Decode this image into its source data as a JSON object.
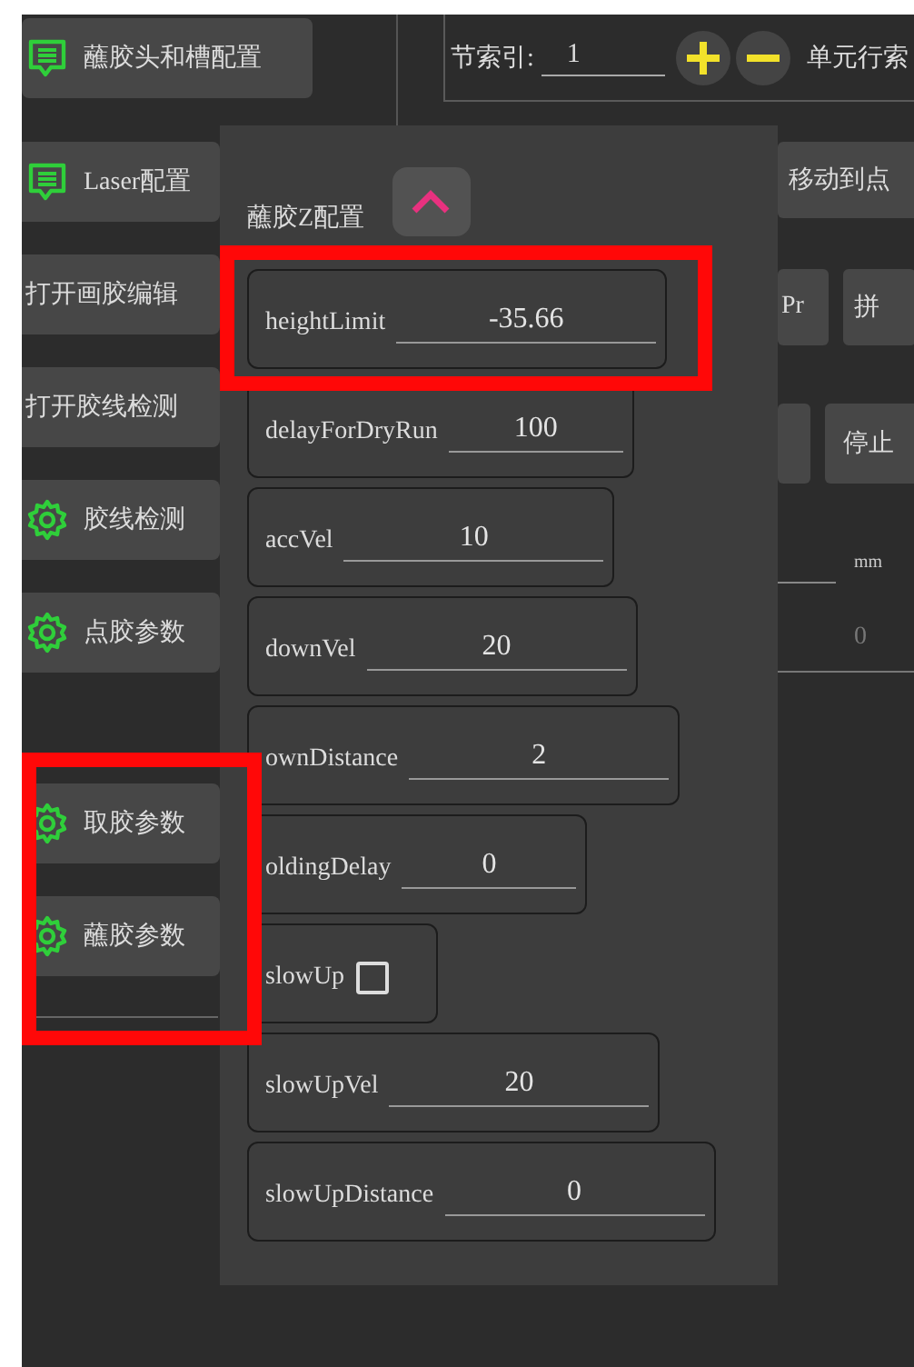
{
  "sidebar": {
    "items": [
      {
        "label": "蘸胶头和槽配置",
        "kind": "message",
        "highlighted": false
      },
      {
        "label": "Laser配置",
        "kind": "message",
        "highlighted": false
      },
      {
        "label": "打开画胶编辑",
        "kind": "plain",
        "highlighted": false
      },
      {
        "label": "打开胶线检测",
        "kind": "plain",
        "highlighted": false
      },
      {
        "label": "胶线检测",
        "kind": "gear",
        "highlighted": false
      },
      {
        "label": "点胶参数",
        "kind": "gear",
        "highlighted": false
      },
      {
        "label": "取胶参数",
        "kind": "gear",
        "highlighted": true
      },
      {
        "label": "蘸胶参数",
        "kind": "gear",
        "highlighted": true
      }
    ]
  },
  "index_bar": {
    "label": "节索引:",
    "value": "1",
    "next_label": "单元行索"
  },
  "behind_controls": {
    "move_button": "移动到点",
    "row_buttons": [
      "Pr",
      "拼"
    ],
    "stop_button": "停止",
    "unit": "mm",
    "placeholder": "0"
  },
  "popup": {
    "title": "蘸胶Z配置",
    "expanded": true,
    "fields": [
      {
        "kind": "number",
        "label": "heightLimit",
        "value": "-35.66",
        "highlighted": true
      },
      {
        "kind": "number",
        "label": "delayForDryRun",
        "value": "100",
        "highlighted": false
      },
      {
        "kind": "number",
        "label": "accVel",
        "value": "10",
        "highlighted": false
      },
      {
        "kind": "number",
        "label": "downVel",
        "value": "20",
        "highlighted": false
      },
      {
        "kind": "number",
        "label": "ownDistance",
        "value": "2",
        "highlighted": false
      },
      {
        "kind": "number",
        "label": "oldingDelay",
        "value": "0",
        "highlighted": false
      },
      {
        "kind": "checkbox",
        "label": "slowUp",
        "checked": false,
        "highlighted": false
      },
      {
        "kind": "number",
        "label": "slowUpVel",
        "value": "20",
        "highlighted": false
      },
      {
        "kind": "number",
        "label": "slowUpDistance",
        "value": "0",
        "highlighted": false
      }
    ]
  }
}
